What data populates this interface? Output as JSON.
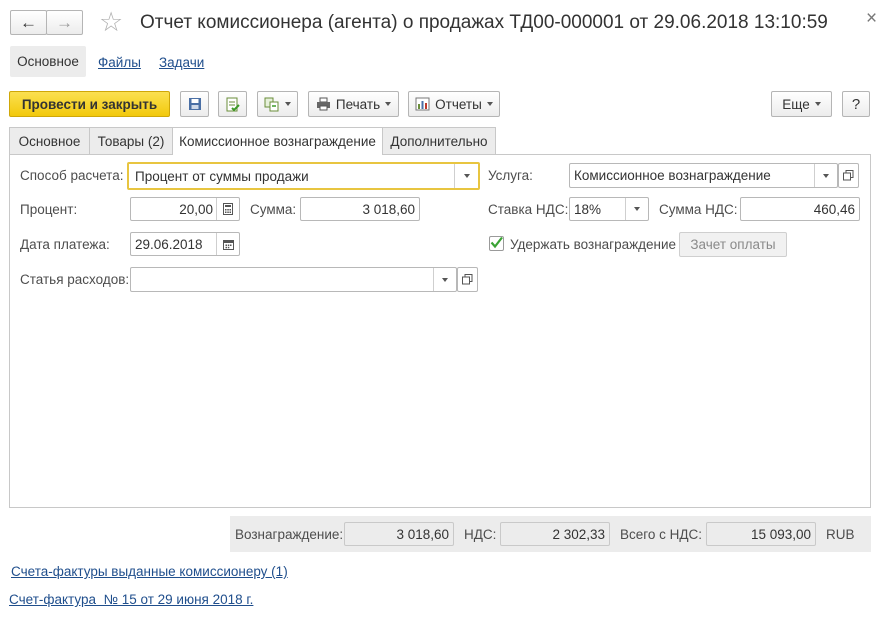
{
  "window": {
    "title": "Отчет комиссионера (агента) о продажах ТД00-000001 от 29.06.2018 13:10:59",
    "back_label": "←",
    "forward_label": "→",
    "star_label": "☆",
    "close_label": "×"
  },
  "nav_tabs": [
    {
      "label": "Основное"
    },
    {
      "label": "Файлы"
    },
    {
      "label": "Задачи"
    }
  ],
  "toolbar": {
    "post_close_label": "Провести и закрыть",
    "print_label": "Печать",
    "reports_label": "Отчеты",
    "more_label": "Еще",
    "help_label": "?"
  },
  "tabs": [
    {
      "label": "Основное"
    },
    {
      "label": "Товары (2)"
    },
    {
      "label": "Комиссионное вознаграждение"
    },
    {
      "label": "Дополнительно"
    }
  ],
  "form": {
    "calc_method": {
      "label": "Способ расчета:",
      "value": "Процент от суммы продажи"
    },
    "service": {
      "label": "Услуга:",
      "value": "Комиссионное вознаграждение"
    },
    "percent": {
      "label": "Процент:",
      "value": "20,00"
    },
    "sum": {
      "label": "Сумма:",
      "value": "3 018,60"
    },
    "vat_rate": {
      "label": "Ставка НДС:",
      "value": "18%"
    },
    "vat_sum": {
      "label": "Сумма НДС:",
      "value": "460,46"
    },
    "pay_date": {
      "label": "Дата платежа:",
      "value": "29.06.2018"
    },
    "withhold": {
      "label": "Удержать вознаграждение",
      "checked": true
    },
    "offset_label": "Зачет оплаты",
    "expense_item": {
      "label": "Статья расходов:",
      "value": ""
    }
  },
  "totals": {
    "reward_label": "Вознаграждение:",
    "reward_value": "3 018,60",
    "vat_label": "НДС:",
    "vat_value": "2 302,33",
    "total_label": "Всего с НДС:",
    "total_value": "15 093,00",
    "currency": "RUB"
  },
  "links": {
    "invoices_issued": "Счета-фактуры выданные комиссионеру (1)",
    "invoice": "Счет-фактура  № 15 от 29 июня 2018 г."
  },
  "colors": {
    "accent_yellow": "#f8d41d",
    "link_blue": "#1f4e8c",
    "focus_border": "#e8c540"
  }
}
